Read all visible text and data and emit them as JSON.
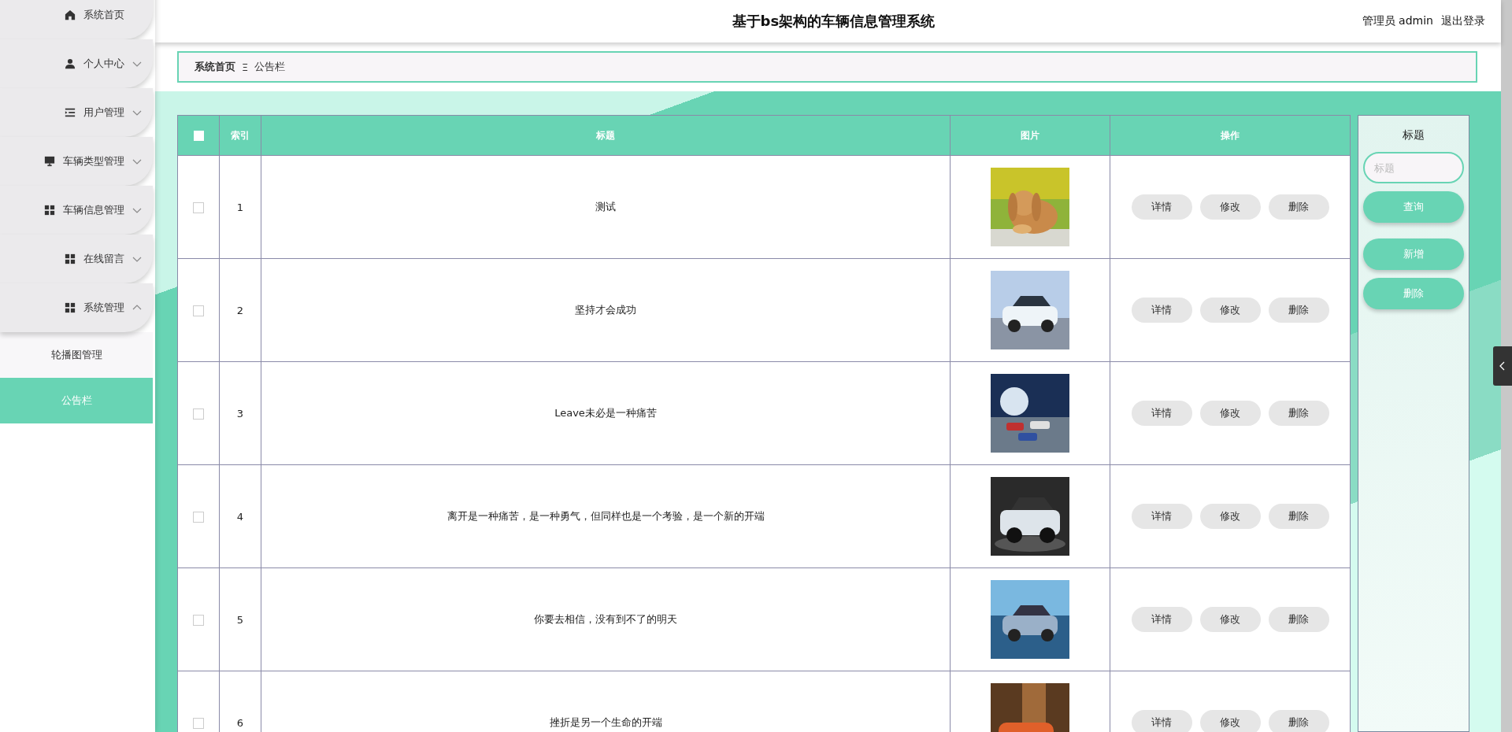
{
  "sidebar": {
    "items": [
      {
        "label": "系统首页",
        "kind": "home"
      },
      {
        "label": "个人中心",
        "kind": "person",
        "expanded": false
      },
      {
        "label": "用户管理",
        "kind": "list",
        "expanded": false
      },
      {
        "label": "车辆类型管理",
        "kind": "monitor",
        "expanded": false
      },
      {
        "label": "车辆信息管理",
        "kind": "grid",
        "expanded": false
      },
      {
        "label": "在线留言",
        "kind": "grid",
        "expanded": false
      },
      {
        "label": "系统管理",
        "kind": "grid",
        "expanded": true,
        "children": [
          {
            "label": "轮播图管理",
            "selected": false
          },
          {
            "label": "公告栏",
            "selected": true
          }
        ]
      }
    ]
  },
  "header": {
    "title": "基于bs架构的车辆信息管理系统",
    "user": "管理员 admin",
    "logout": "退出登录"
  },
  "breadcrumb": {
    "items": [
      "系统首页",
      "公告栏"
    ],
    "separator": "Ξ"
  },
  "table": {
    "columns": [
      "索引",
      "标题",
      "图片",
      "操作"
    ],
    "rows": [
      {
        "index": "1",
        "title": "测试",
        "checked": false,
        "image": {
          "kind": "picture"
        },
        "actions": [
          "详情",
          "修改",
          "删除"
        ]
      },
      {
        "index": "2",
        "title": "坚持才会成功",
        "checked": false,
        "image": {
          "kind": "picture"
        },
        "actions": [
          "详情",
          "修改",
          "删除"
        ]
      },
      {
        "index": "3",
        "title": "Leave未必是一种痛苦",
        "checked": false,
        "image": {
          "kind": "picture"
        },
        "actions": [
          "详情",
          "修改",
          "删除"
        ]
      },
      {
        "index": "4",
        "title": "离开是一种痛苦，是一种勇气，但同样也是一个考验，是一个新的开端",
        "checked": false,
        "image": {
          "kind": "picture"
        },
        "actions": [
          "详情",
          "修改",
          "删除"
        ]
      },
      {
        "index": "5",
        "title": "你要去相信，没有到不了的明天",
        "checked": false,
        "image": {
          "kind": "picture"
        },
        "actions": [
          "详情",
          "修改",
          "删除"
        ]
      },
      {
        "index": "6",
        "title": "挫折是另一个生命的开端",
        "checked": false,
        "image": {
          "kind": "picture"
        },
        "actions": [
          "详情",
          "修改",
          "删除"
        ]
      }
    ],
    "select_all": false
  },
  "search_panel": {
    "label": "标题",
    "placeholder": "标题",
    "buttons": [
      "查询",
      "新增",
      "删除"
    ]
  }
}
